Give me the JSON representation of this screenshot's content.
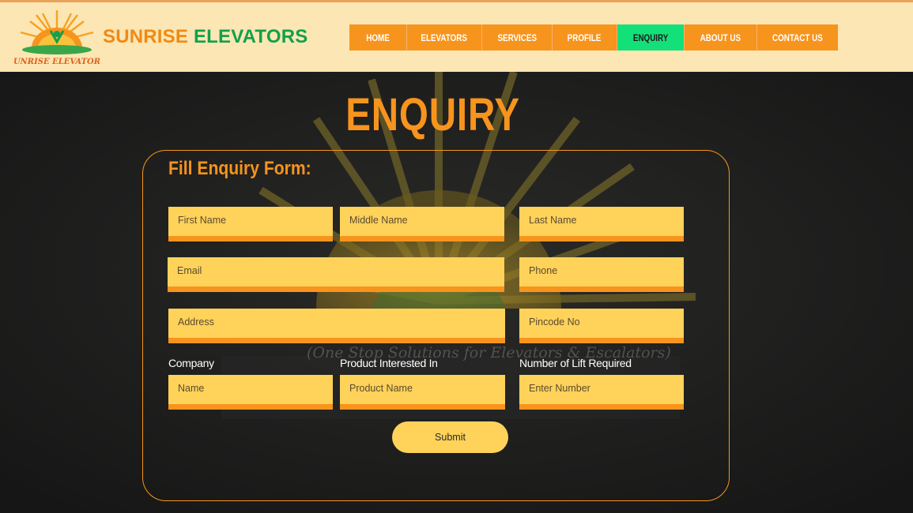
{
  "brand": {
    "word1": "SUNRISE",
    "word2": "ELEVATORS",
    "logo_text": "SUNRISE ELEVATORS"
  },
  "nav": {
    "items": [
      {
        "label": "HOME"
      },
      {
        "label": "ELEVATORS"
      },
      {
        "label": "SERVICES"
      },
      {
        "label": "PROFILE"
      },
      {
        "label": "ENQUIRY",
        "active": true
      },
      {
        "label": "ABOUT US"
      },
      {
        "label": "CONTACT US"
      }
    ]
  },
  "page": {
    "title": "ENQUIRY",
    "form_heading": "Fill Enquiry Form:",
    "background_tagline": "(One Stop Solutions for Elevators & Escalators)"
  },
  "form": {
    "first_name": {
      "placeholder": "First Name",
      "value": ""
    },
    "middle_name": {
      "placeholder": "Middle Name",
      "value": ""
    },
    "last_name": {
      "placeholder": "Last Name",
      "value": ""
    },
    "email": {
      "placeholder": "Email",
      "value": ""
    },
    "phone": {
      "placeholder": "Phone",
      "value": ""
    },
    "address": {
      "placeholder": "Address",
      "value": ""
    },
    "pincode": {
      "placeholder": "Pincode No",
      "value": ""
    },
    "company": {
      "label": "Company",
      "placeholder": "Name",
      "value": ""
    },
    "product": {
      "label": "Product Interested In",
      "placeholder": "Product Name",
      "value": ""
    },
    "lifts": {
      "label": "Number of Lift Required",
      "placeholder": "Enter Number",
      "value": ""
    },
    "submit_label": "Submit"
  },
  "colors": {
    "accent": "#f7941d",
    "brand_green": "#13a04a",
    "nav_active": "#14e07a",
    "field_bg": "#ffd25a",
    "header_bg": "#fbe6b4",
    "page_bg": "#1f1f1f"
  }
}
